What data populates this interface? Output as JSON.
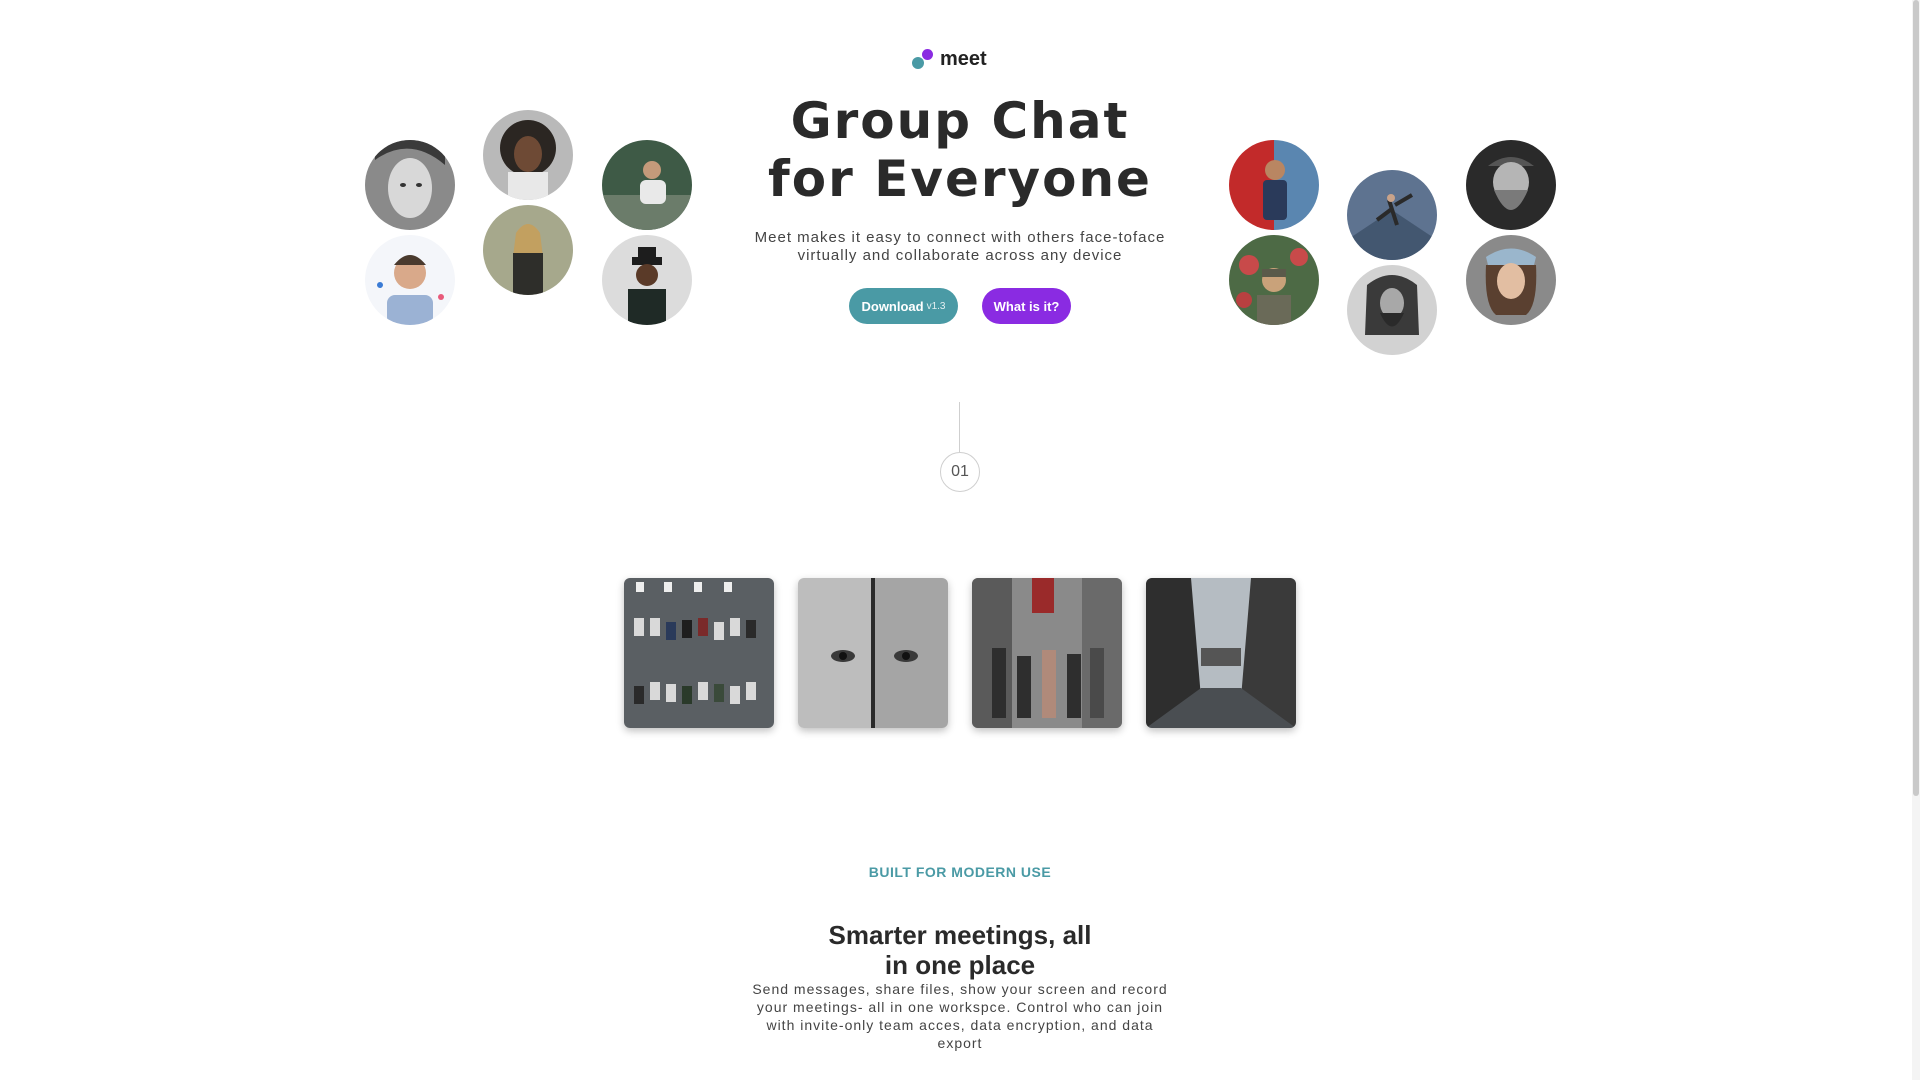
{
  "brand": {
    "name": "meet",
    "accent": "#4a9aa5",
    "secondary": "#8a2be2"
  },
  "hero": {
    "title_line1": "Group Chat",
    "title_line2": "for Everyone",
    "subtitle": "Meet makes it easy to connect with others face-toface virtually and collaborate across any device",
    "download_label": "Download",
    "download_version": "v1.3",
    "what_label": "What is it?"
  },
  "step": {
    "number": "01"
  },
  "features": {
    "eyebrow": "BUILT FOR MODERN USE",
    "title_line1": "Smarter meetings, all",
    "title_line2": "in one place",
    "body": "Send messages, share files, show your screen and record your meetings- all in one workspce. Control who can join with invite-only team acces, data encryption, and data export"
  },
  "icons": {
    "logo": "logo-dots-icon"
  }
}
